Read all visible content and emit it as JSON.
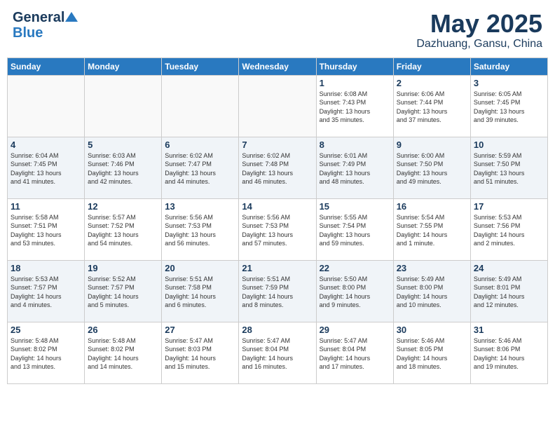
{
  "header": {
    "logo_line1": "General",
    "logo_line2": "Blue",
    "month": "May 2025",
    "location": "Dazhuang, Gansu, China"
  },
  "weekdays": [
    "Sunday",
    "Monday",
    "Tuesday",
    "Wednesday",
    "Thursday",
    "Friday",
    "Saturday"
  ],
  "weeks": [
    [
      {
        "day": "",
        "info": ""
      },
      {
        "day": "",
        "info": ""
      },
      {
        "day": "",
        "info": ""
      },
      {
        "day": "",
        "info": ""
      },
      {
        "day": "1",
        "info": "Sunrise: 6:08 AM\nSunset: 7:43 PM\nDaylight: 13 hours\nand 35 minutes."
      },
      {
        "day": "2",
        "info": "Sunrise: 6:06 AM\nSunset: 7:44 PM\nDaylight: 13 hours\nand 37 minutes."
      },
      {
        "day": "3",
        "info": "Sunrise: 6:05 AM\nSunset: 7:45 PM\nDaylight: 13 hours\nand 39 minutes."
      }
    ],
    [
      {
        "day": "4",
        "info": "Sunrise: 6:04 AM\nSunset: 7:45 PM\nDaylight: 13 hours\nand 41 minutes."
      },
      {
        "day": "5",
        "info": "Sunrise: 6:03 AM\nSunset: 7:46 PM\nDaylight: 13 hours\nand 42 minutes."
      },
      {
        "day": "6",
        "info": "Sunrise: 6:02 AM\nSunset: 7:47 PM\nDaylight: 13 hours\nand 44 minutes."
      },
      {
        "day": "7",
        "info": "Sunrise: 6:02 AM\nSunset: 7:48 PM\nDaylight: 13 hours\nand 46 minutes."
      },
      {
        "day": "8",
        "info": "Sunrise: 6:01 AM\nSunset: 7:49 PM\nDaylight: 13 hours\nand 48 minutes."
      },
      {
        "day": "9",
        "info": "Sunrise: 6:00 AM\nSunset: 7:50 PM\nDaylight: 13 hours\nand 49 minutes."
      },
      {
        "day": "10",
        "info": "Sunrise: 5:59 AM\nSunset: 7:50 PM\nDaylight: 13 hours\nand 51 minutes."
      }
    ],
    [
      {
        "day": "11",
        "info": "Sunrise: 5:58 AM\nSunset: 7:51 PM\nDaylight: 13 hours\nand 53 minutes."
      },
      {
        "day": "12",
        "info": "Sunrise: 5:57 AM\nSunset: 7:52 PM\nDaylight: 13 hours\nand 54 minutes."
      },
      {
        "day": "13",
        "info": "Sunrise: 5:56 AM\nSunset: 7:53 PM\nDaylight: 13 hours\nand 56 minutes."
      },
      {
        "day": "14",
        "info": "Sunrise: 5:56 AM\nSunset: 7:53 PM\nDaylight: 13 hours\nand 57 minutes."
      },
      {
        "day": "15",
        "info": "Sunrise: 5:55 AM\nSunset: 7:54 PM\nDaylight: 13 hours\nand 59 minutes."
      },
      {
        "day": "16",
        "info": "Sunrise: 5:54 AM\nSunset: 7:55 PM\nDaylight: 14 hours\nand 1 minute."
      },
      {
        "day": "17",
        "info": "Sunrise: 5:53 AM\nSunset: 7:56 PM\nDaylight: 14 hours\nand 2 minutes."
      }
    ],
    [
      {
        "day": "18",
        "info": "Sunrise: 5:53 AM\nSunset: 7:57 PM\nDaylight: 14 hours\nand 4 minutes."
      },
      {
        "day": "19",
        "info": "Sunrise: 5:52 AM\nSunset: 7:57 PM\nDaylight: 14 hours\nand 5 minutes."
      },
      {
        "day": "20",
        "info": "Sunrise: 5:51 AM\nSunset: 7:58 PM\nDaylight: 14 hours\nand 6 minutes."
      },
      {
        "day": "21",
        "info": "Sunrise: 5:51 AM\nSunset: 7:59 PM\nDaylight: 14 hours\nand 8 minutes."
      },
      {
        "day": "22",
        "info": "Sunrise: 5:50 AM\nSunset: 8:00 PM\nDaylight: 14 hours\nand 9 minutes."
      },
      {
        "day": "23",
        "info": "Sunrise: 5:49 AM\nSunset: 8:00 PM\nDaylight: 14 hours\nand 10 minutes."
      },
      {
        "day": "24",
        "info": "Sunrise: 5:49 AM\nSunset: 8:01 PM\nDaylight: 14 hours\nand 12 minutes."
      }
    ],
    [
      {
        "day": "25",
        "info": "Sunrise: 5:48 AM\nSunset: 8:02 PM\nDaylight: 14 hours\nand 13 minutes."
      },
      {
        "day": "26",
        "info": "Sunrise: 5:48 AM\nSunset: 8:02 PM\nDaylight: 14 hours\nand 14 minutes."
      },
      {
        "day": "27",
        "info": "Sunrise: 5:47 AM\nSunset: 8:03 PM\nDaylight: 14 hours\nand 15 minutes."
      },
      {
        "day": "28",
        "info": "Sunrise: 5:47 AM\nSunset: 8:04 PM\nDaylight: 14 hours\nand 16 minutes."
      },
      {
        "day": "29",
        "info": "Sunrise: 5:47 AM\nSunset: 8:04 PM\nDaylight: 14 hours\nand 17 minutes."
      },
      {
        "day": "30",
        "info": "Sunrise: 5:46 AM\nSunset: 8:05 PM\nDaylight: 14 hours\nand 18 minutes."
      },
      {
        "day": "31",
        "info": "Sunrise: 5:46 AM\nSunset: 8:06 PM\nDaylight: 14 hours\nand 19 minutes."
      }
    ]
  ]
}
